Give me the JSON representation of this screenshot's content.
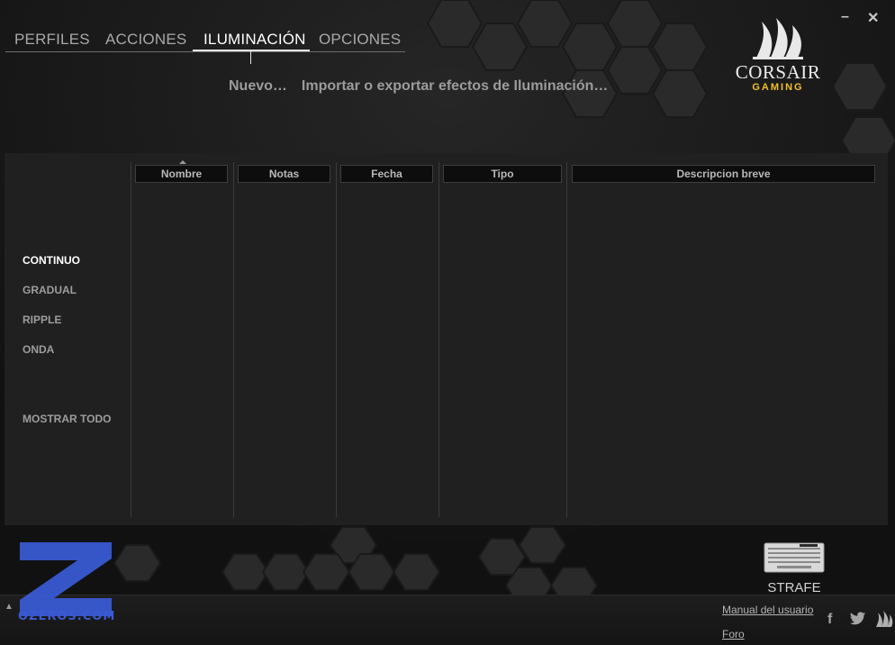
{
  "window": {
    "minimize_glyph": "–",
    "close_glyph": "✕"
  },
  "nav": {
    "tabs": [
      {
        "label": "PERFILES",
        "active": false
      },
      {
        "label": "ACCIONES",
        "active": false
      },
      {
        "label": "ILUMINACIÓN",
        "active": true
      },
      {
        "label": "OPCIONES",
        "active": false
      }
    ]
  },
  "actions": {
    "new": "Nuevo…",
    "import_export": "Importar o exportar efectos de Iluminación…"
  },
  "brand": {
    "name": "CORSAIR",
    "sub": "GAMING",
    "accent_color": "#f2c02e"
  },
  "table": {
    "columns": [
      "Nombre",
      "Notas",
      "Fecha",
      "Tipo",
      "Descripcion breve"
    ],
    "rows": []
  },
  "sidebar": {
    "items": [
      {
        "label": "CONTINUO",
        "active": true
      },
      {
        "label": "GRADUAL",
        "active": false
      },
      {
        "label": "RIPPLE",
        "active": false
      },
      {
        "label": "ONDA",
        "active": false
      }
    ],
    "show_all": "MOSTRAR TODO"
  },
  "device": {
    "name": "STRAFE",
    "icon": "keyboard-icon"
  },
  "footer": {
    "manual": "Manual del usuario",
    "forum": "Foro",
    "social_icons": [
      "facebook-icon",
      "twitter-icon",
      "corsair-sails-icon"
    ]
  },
  "watermark": {
    "letter": "Z",
    "text": "OZEROS.COM",
    "color": "#3a5bd6"
  }
}
